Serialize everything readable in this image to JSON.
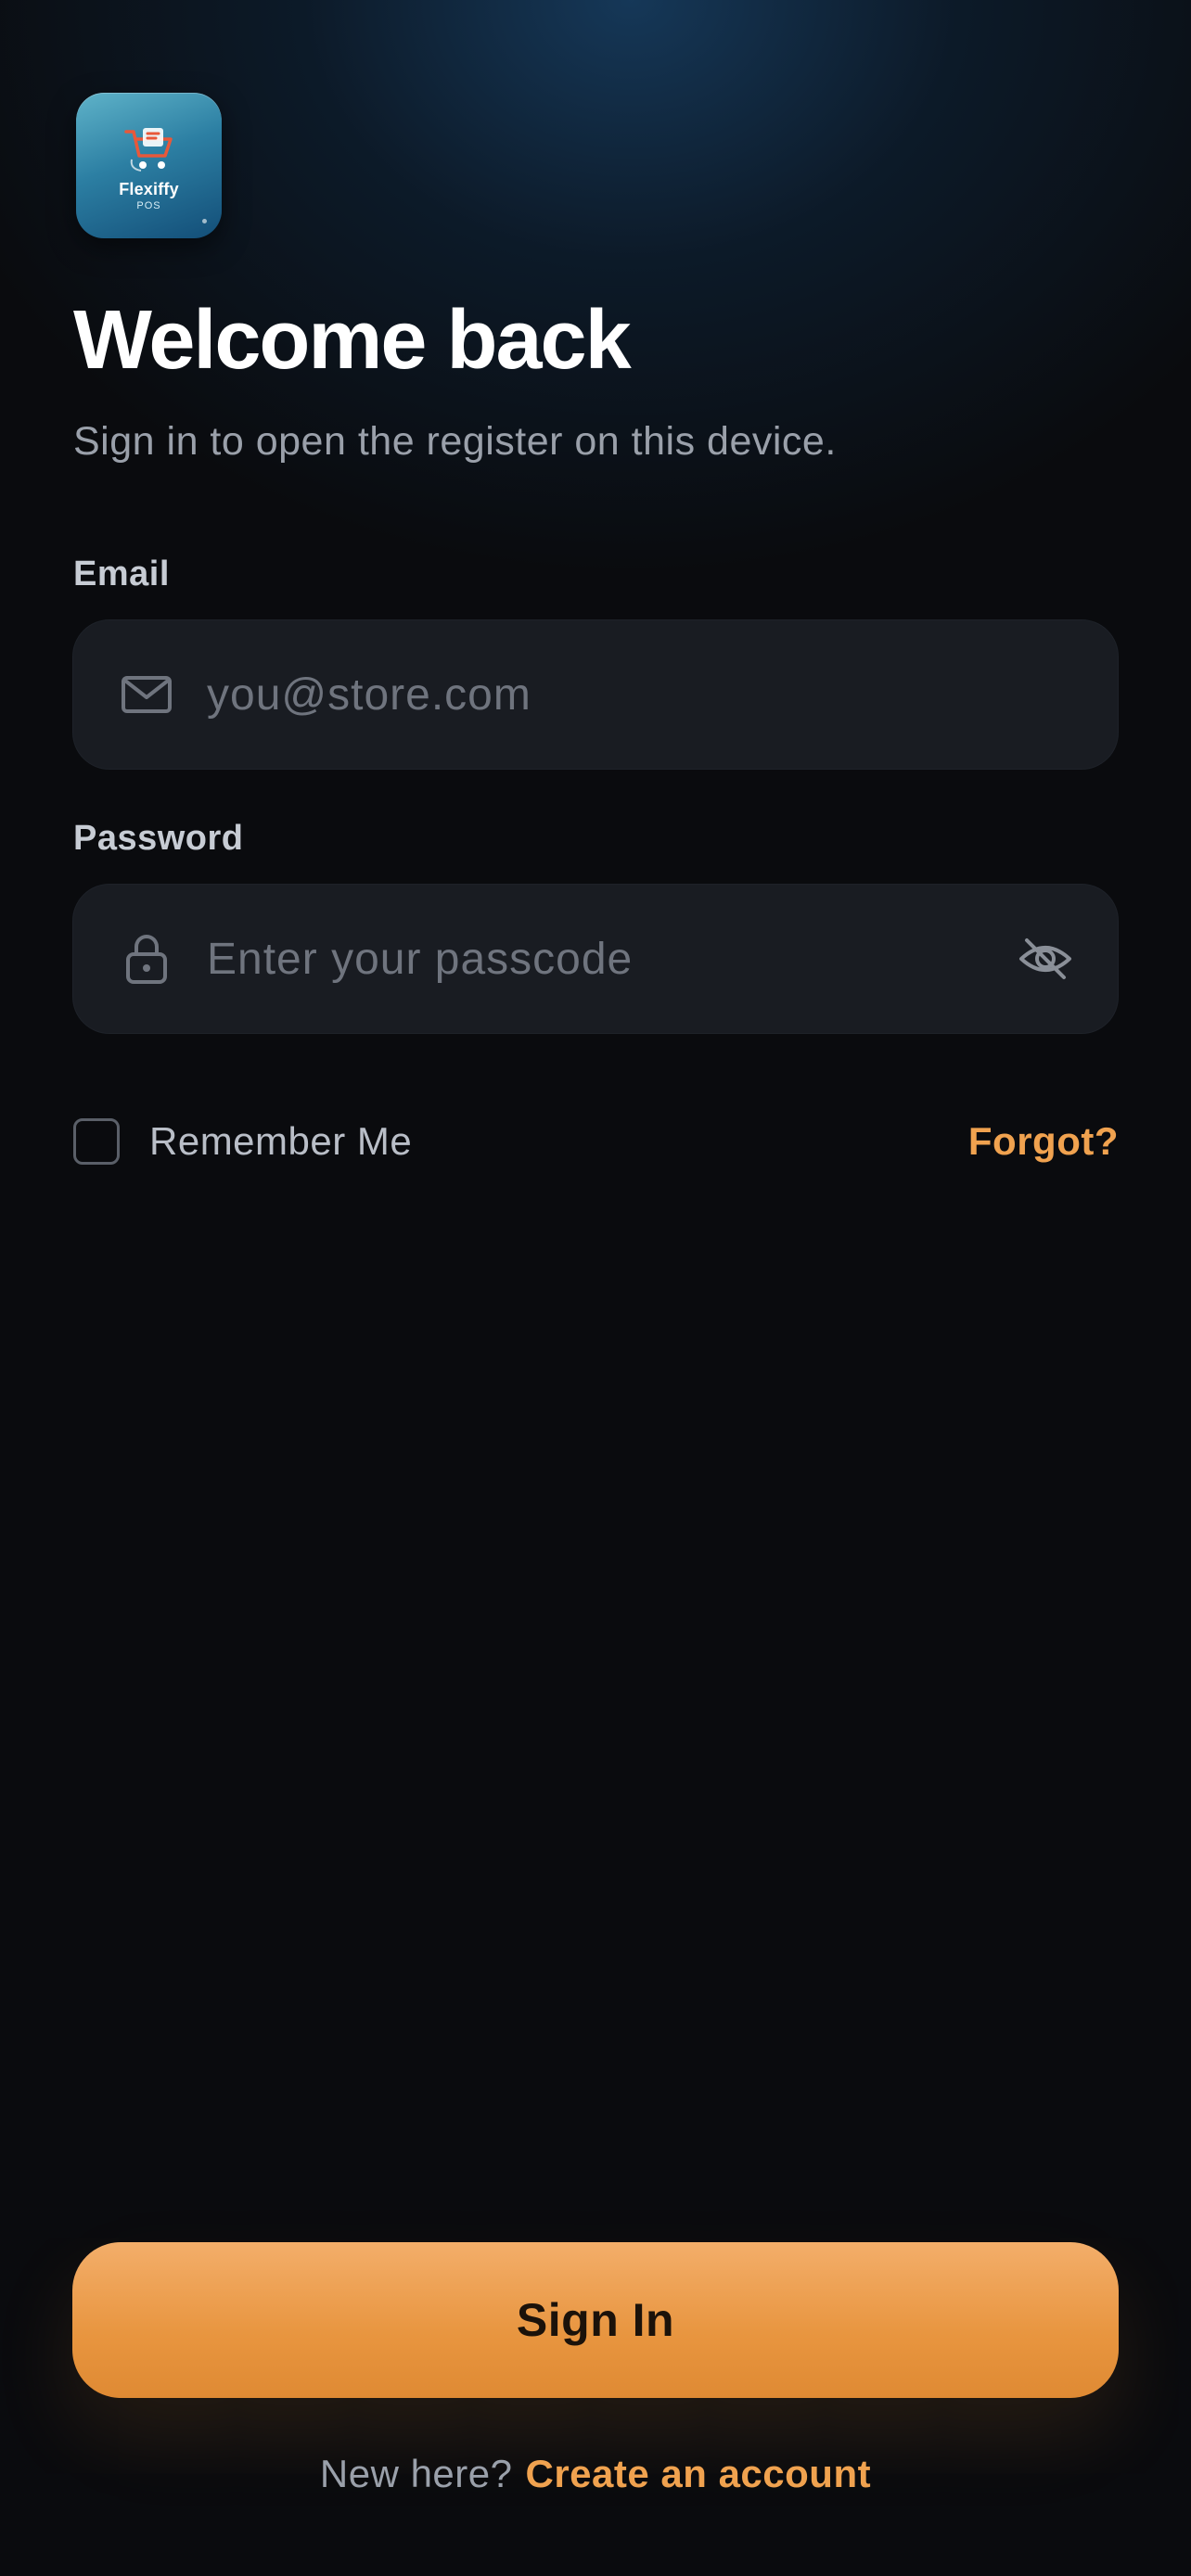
{
  "app": {
    "logo_name": "Flexiffy",
    "logo_sub": "POS",
    "logo_icon": "shopping-cart-icon"
  },
  "header": {
    "title": "Welcome back",
    "subtitle": "Sign in to open the register on this device."
  },
  "form": {
    "email": {
      "label": "Email",
      "placeholder": "you@store.com",
      "value": "",
      "icon": "mail-icon"
    },
    "password": {
      "label": "Password",
      "placeholder": "Enter your passcode",
      "value": "",
      "icon": "lock-icon",
      "toggle_icon": "eye-off-icon"
    },
    "remember_label": "Remember Me",
    "remember_checked": false,
    "forgot_label": "Forgot?"
  },
  "actions": {
    "signin_label": "Sign In",
    "new_here": "New here?",
    "create_account": "Create an account"
  },
  "colors": {
    "accent": "#f0a24f",
    "button_top": "#f3ae6a",
    "button_bottom": "#df8a33",
    "background": "#0a0b0e",
    "input_bg": "#191c22"
  }
}
